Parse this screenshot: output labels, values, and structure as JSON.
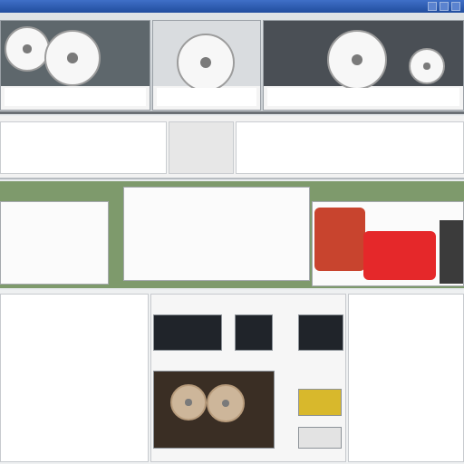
{
  "window": {
    "title": "",
    "colors": {
      "titlebar": "#2f5fb5",
      "banner": "#7e9a6c",
      "accent_red": "#e5282a",
      "accent_gold": "#d8b82c"
    }
  },
  "shelf": {
    "tiles": [
      {
        "caption": ""
      },
      {
        "caption": ""
      },
      {
        "caption": ""
      }
    ]
  },
  "ribbon": {
    "columns": [
      {
        "lines": [
          "",
          "",
          "",
          ""
        ]
      },
      {
        "lines": [
          "",
          "",
          "",
          ""
        ]
      },
      {
        "lines": [
          "",
          "",
          "",
          ""
        ]
      }
    ]
  },
  "banner": {
    "left_panel": {
      "heading": "",
      "lines": [
        "",
        "",
        "",
        "",
        "",
        ""
      ]
    },
    "center_panel": {
      "heading": "",
      "lines": [
        "",
        "",
        "",
        "",
        "",
        "",
        ""
      ]
    }
  },
  "grid": {
    "left_col": {
      "lines": [
        "",
        "",
        "",
        "",
        "",
        "",
        "",
        "",
        "",
        "",
        "",
        "",
        "",
        "",
        "",
        "",
        ""
      ]
    },
    "right_col": {
      "lines": [
        "",
        "",
        "",
        "",
        "",
        "",
        "",
        "",
        "",
        "",
        "",
        "",
        "",
        "",
        "",
        "",
        ""
      ]
    }
  }
}
